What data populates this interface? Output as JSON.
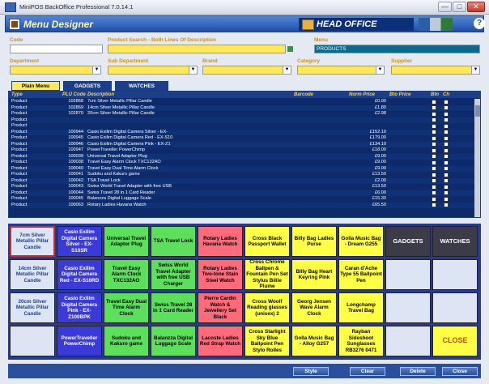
{
  "window": {
    "title": "MiniPOS BackOffice Professional 7.0.14.1",
    "minimize": "—",
    "maximize": "□",
    "close": "✕"
  },
  "header": {
    "title": "Menu Designer",
    "office": "HEAD OFFICE",
    "help": "?"
  },
  "filters": {
    "code_label": "Code",
    "code_value": "",
    "search_label": "Product Search - Both Lines Of Description",
    "search_value": "",
    "menu_label": "Menu",
    "menu_value": "PRODUCTS",
    "department_label": "Department",
    "subdepartment_label": "Sub Department",
    "brand_label": "Brand",
    "category_label": "Category",
    "supplier_label": "Supplier"
  },
  "tabs": [
    "Plain Menu",
    "GADGETS",
    "WATCHES"
  ],
  "grid": {
    "headers": [
      "Type",
      "PLU Code",
      "Description",
      "Barcode",
      "Norm Price",
      "Bto Price",
      "Btn",
      "Ch"
    ],
    "rows": [
      {
        "type": "Product",
        "plu": "102868",
        "desc": "7cm Silver Metallic Pillar Candle",
        "barcode": "",
        "price": "£0.90"
      },
      {
        "type": "Product",
        "plu": "102869",
        "desc": "14cm Silver Metallic Pillar Candle",
        "barcode": "",
        "price": "£1.80"
      },
      {
        "type": "Product",
        "plu": "102870",
        "desc": "20cm Silver Metallic Pillar Candle",
        "barcode": "",
        "price": "£2.98"
      },
      {
        "type": "Product",
        "plu": "",
        "desc": "",
        "barcode": "",
        "price": ""
      },
      {
        "type": "Product",
        "plu": "",
        "desc": "",
        "barcode": "",
        "price": ""
      },
      {
        "type": "Product",
        "plu": "100944",
        "desc": "Casio Exilim Digital Camera Silver - EX-",
        "barcode": "",
        "price": "£152.10"
      },
      {
        "type": "Product",
        "plu": "100945",
        "desc": "Casio Exilim Digital Camera Red - EX-S10",
        "barcode": "",
        "price": "£179.00"
      },
      {
        "type": "Product",
        "plu": "100946",
        "desc": "Casio Exilim Digital Camera Pink - EX-Z1",
        "barcode": "",
        "price": "£134.10"
      },
      {
        "type": "Product",
        "plu": "100947",
        "desc": "PowerTraveller PowerChimp",
        "barcode": "",
        "price": "£18.00"
      },
      {
        "type": "Product",
        "plu": "100039",
        "desc": "Universal Travel Adaptor Plug",
        "barcode": "",
        "price": "£9.00"
      },
      {
        "type": "Product",
        "plu": "100038",
        "desc": "Travel Easy Alarm Clock TXC132AO",
        "barcode": "",
        "price": "£9.00"
      },
      {
        "type": "Product",
        "plu": "100040",
        "desc": "Travel Easy Dual Time Alarm Clock",
        "barcode": "",
        "price": "£9.00"
      },
      {
        "type": "Product",
        "plu": "100041",
        "desc": "Sudoku and Kakuro game",
        "barcode": "",
        "price": "£13.50"
      },
      {
        "type": "Product",
        "plu": "100042",
        "desc": "TSA Travel Lock",
        "barcode": "",
        "price": "£2.00"
      },
      {
        "type": "Product",
        "plu": "100043",
        "desc": "Swiss World Travel Adapter with free USB",
        "barcode": "",
        "price": "£13.50"
      },
      {
        "type": "Product",
        "plu": "100044",
        "desc": "Swiss Travel 28 in 1 Card Reader",
        "barcode": "",
        "price": "£6.00"
      },
      {
        "type": "Product",
        "plu": "100045",
        "desc": "Balanzza Digital Luggage Scale",
        "barcode": "",
        "price": "£15.30"
      },
      {
        "type": "Product",
        "plu": "100063",
        "desc": "Rotary Ladies Havana Watch",
        "barcode": "",
        "price": "£65.50"
      }
    ]
  },
  "buttons": [
    [
      "7cm Silver Metallic Pillar Candle",
      "Casio Exilim Digital Camera Silver - EX-S10SR",
      "Universal Travel Adaptor Plug",
      "TSA Travel Lock",
      "Rotary Ladies Havana Watch",
      "Cross Black Passport Wallet",
      "Billy Bag Ladies Purse",
      "Golla Music Bag - Dream G255",
      "GADGETS",
      "WATCHES"
    ],
    [
      "14cm Silver Metallic Pillar Candle",
      "Casio Exilim Digital Camera Red - EX-S10RD",
      "Travel Easy Alarm Clock TXC132AO",
      "Swiss World Travel Adapter with free USB Charger",
      "Rotary Ladies Two-tone Stain Steel Watch",
      "Cross Chrome Ballpen & Fountain Pen Set Stylus Billie Plume",
      "Billy Bag Heart Keyring Pink",
      "Caran d'Ache Type 55 Ballpoint Pen",
      "",
      ""
    ],
    [
      "20cm Silver Metallic Pillar Candle",
      "Casio Exilim Digital Camera Pink - EX-Z100BPK",
      "Travel Easy Dual Time Alarm Clock",
      "Swiss Travel 28 in 1 Card Reader",
      "Pierre Cardin Watch & Jewellery Set Black",
      "Cross Woolf Reading glasses (unisex) 2",
      "Georg Jensen Wave Alarm Clock",
      "Longchamp Travel Bag",
      "",
      ""
    ],
    [
      "",
      "PowerTraveller PowerChimp",
      "Sudoku and Kakuro game",
      "Balanzza Digital Luggage Scale",
      "Lacoste Ladies Red Strap Watch",
      "Cross Starlight Sky Blue Ballpoint Pen Stylo Rolles",
      "Golla Music Bag - Alloy G257",
      "Rayban Sideshoot Sunglasses RB3276 0471",
      "",
      "CLOSE"
    ]
  ],
  "footer": {
    "style": "Style",
    "clear": "Clear",
    "delete": "Delete",
    "close": "Close"
  }
}
